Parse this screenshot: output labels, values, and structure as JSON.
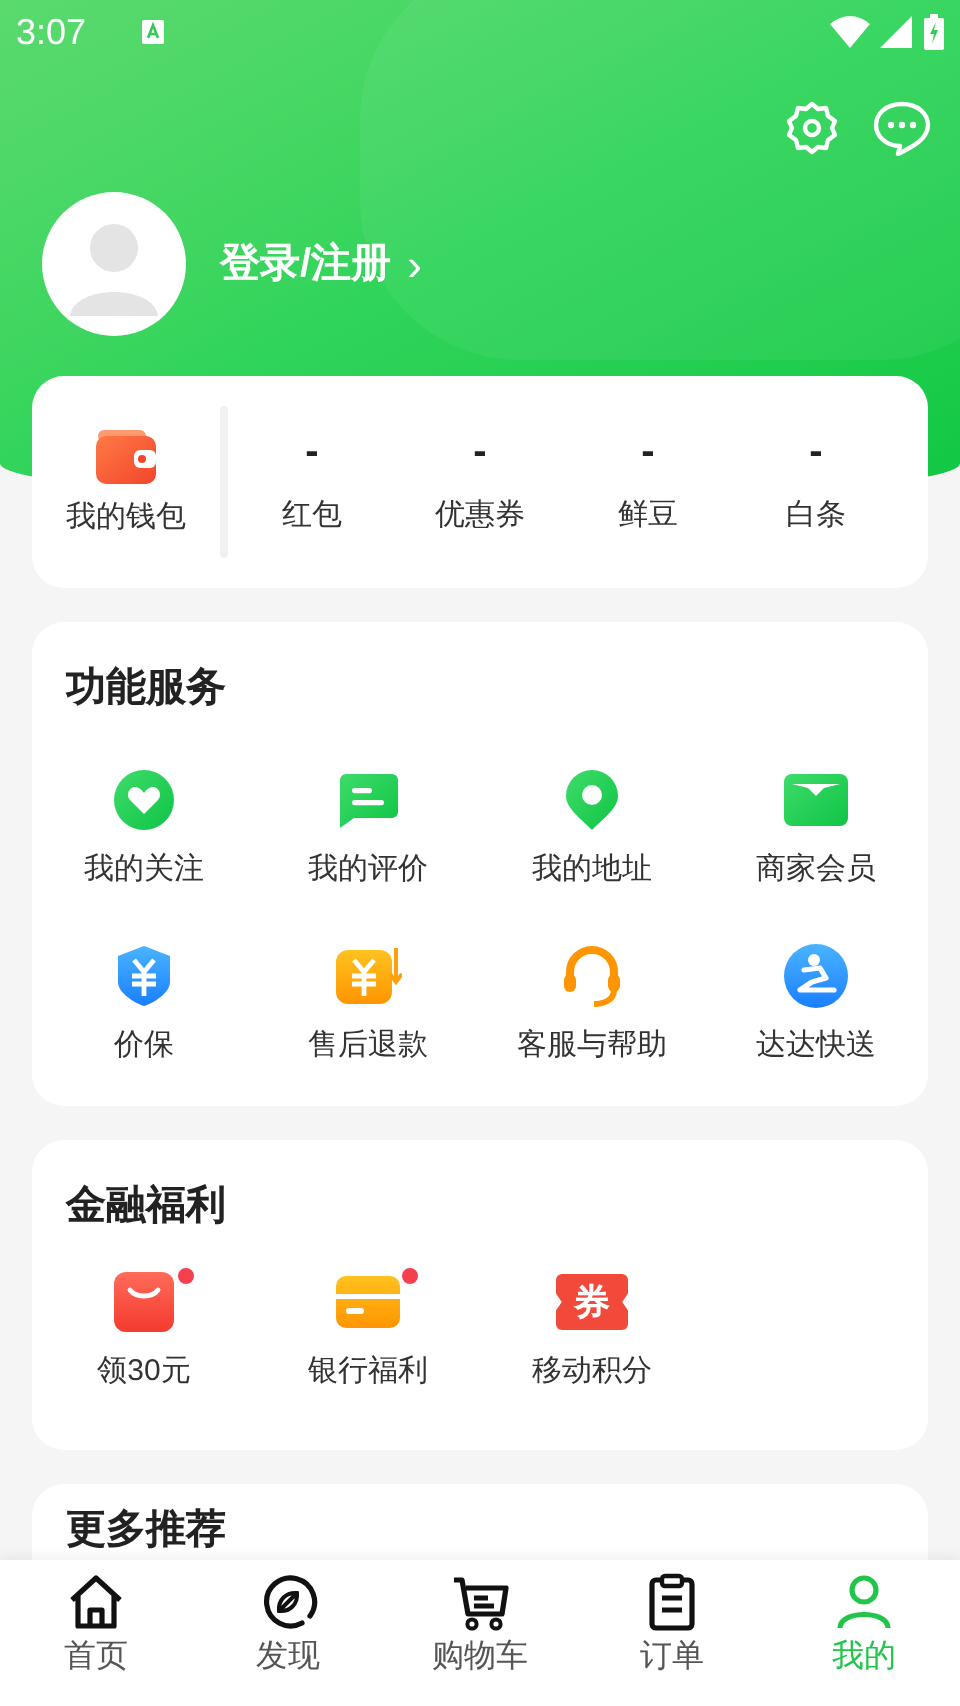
{
  "status_bar": {
    "time": "3:07"
  },
  "header": {
    "login": "登录/注册",
    "chevron": "›"
  },
  "wallet": {
    "label": "我的钱包",
    "stats": [
      {
        "value": "-",
        "label": "红包"
      },
      {
        "value": "-",
        "label": "优惠券"
      },
      {
        "value": "-",
        "label": "鲜豆"
      },
      {
        "value": "-",
        "label": "白条"
      }
    ]
  },
  "services": {
    "title": "功能服务",
    "items": [
      {
        "label": "我的关注",
        "kind": "heart"
      },
      {
        "label": "我的评价",
        "kind": "comment"
      },
      {
        "label": "我的地址",
        "kind": "pin"
      },
      {
        "label": "商家会员",
        "kind": "card"
      },
      {
        "label": "价保",
        "kind": "shield"
      },
      {
        "label": "售后退款",
        "kind": "refund"
      },
      {
        "label": "客服与帮助",
        "kind": "headset"
      },
      {
        "label": "达达快送",
        "kind": "courier"
      }
    ]
  },
  "finance": {
    "title": "金融福利",
    "items": [
      {
        "label": "领30元",
        "kind": "bag",
        "badge": true
      },
      {
        "label": "银行福利",
        "kind": "bankcard",
        "badge": true
      },
      {
        "label": "移动积分",
        "kind": "ticket",
        "icon_text": "券",
        "badge": false
      }
    ]
  },
  "more": {
    "title": "更多推荐"
  },
  "nav": {
    "items": [
      {
        "label": "首页",
        "kind": "home",
        "selected": false
      },
      {
        "label": "发现",
        "kind": "compass",
        "selected": false
      },
      {
        "label": "购物车",
        "kind": "cart",
        "selected": false
      },
      {
        "label": "订单",
        "kind": "orders",
        "selected": false
      },
      {
        "label": "我的",
        "kind": "person",
        "selected": true
      }
    ]
  }
}
